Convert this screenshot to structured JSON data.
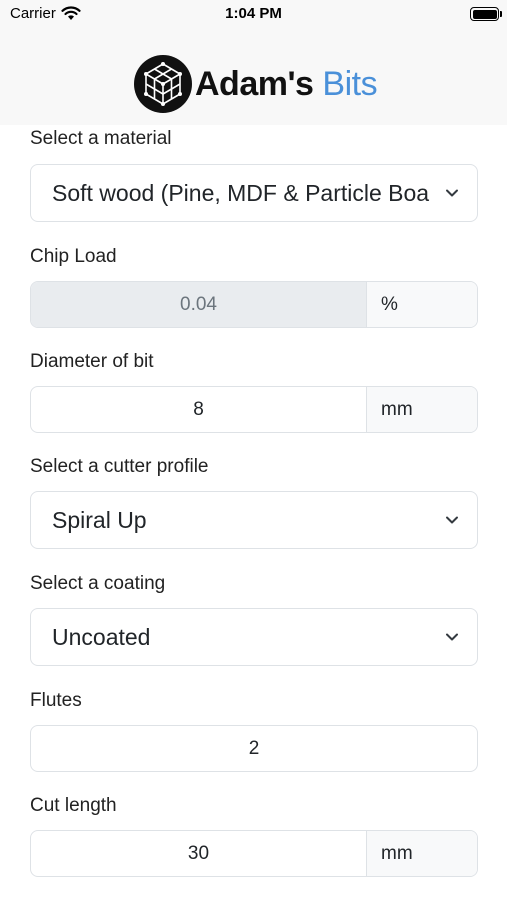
{
  "status_bar": {
    "carrier": "Carrier",
    "time": "1:04 PM"
  },
  "header": {
    "logo_text_primary": "Adam's",
    "logo_text_accent": "Bits",
    "accent_color": "#4a90d9"
  },
  "form": {
    "material": {
      "label": "Select a material",
      "value": "Soft wood (Pine, MDF & Particle Boa"
    },
    "chip_load": {
      "label": "Chip Load",
      "value": "0.04",
      "unit": "%"
    },
    "diameter": {
      "label": "Diameter of bit",
      "value": "8",
      "unit": "mm"
    },
    "cutter_profile": {
      "label": "Select a cutter profile",
      "value": "Spiral Up"
    },
    "coating": {
      "label": "Select a coating",
      "value": "Uncoated"
    },
    "flutes": {
      "label": "Flutes",
      "value": "2"
    },
    "cut_length": {
      "label": "Cut length",
      "value": "30",
      "unit": "mm"
    }
  }
}
